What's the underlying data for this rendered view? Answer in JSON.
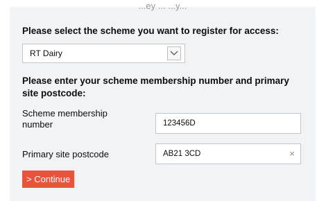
{
  "header": {
    "clipped_text": "...ey ... ...y..."
  },
  "scheme": {
    "heading": "Please select the scheme you want to register for access:",
    "selected": "RT Dairy"
  },
  "membership": {
    "heading": "Please enter your scheme membership number and primary site postcode:",
    "number_label": "Scheme membership number",
    "number_value": "123456D",
    "postcode_label": "Primary site postcode",
    "postcode_value": "AB21 3CD",
    "clear_glyph": "×"
  },
  "actions": {
    "continue_label": "> Continue"
  },
  "colors": {
    "panel_background": "#f0f4f6",
    "button_background": "#e8533b",
    "button_text": "#ffffff"
  },
  "icons": {
    "dropdown": "chevron-down-icon",
    "clear": "clear-icon"
  }
}
